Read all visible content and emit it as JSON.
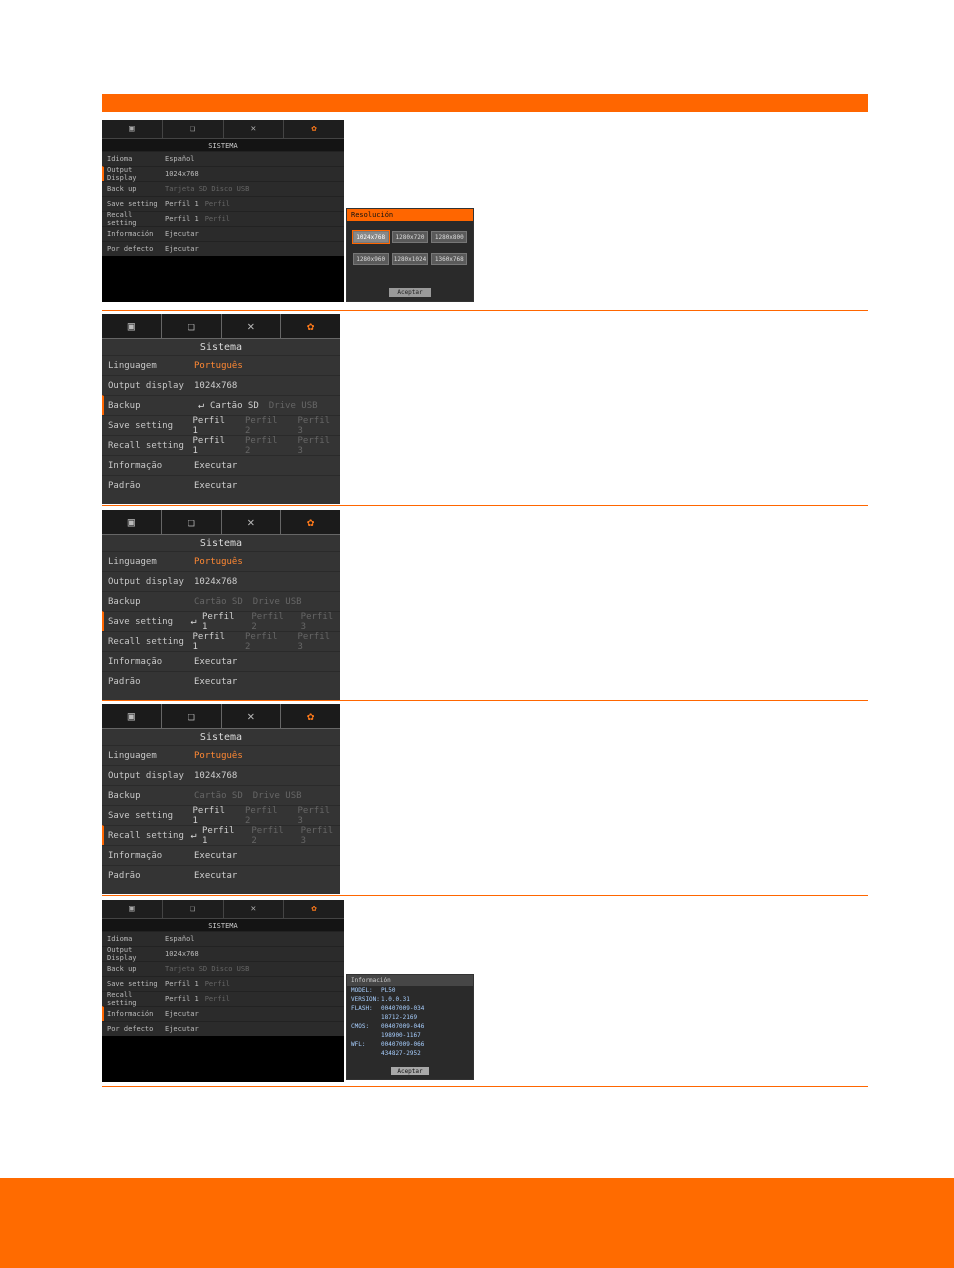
{
  "tabs": {
    "icon1": "picture-icon",
    "icon2": "layers-icon",
    "icon3": "tools-icon",
    "icon4": "gear-icon"
  },
  "p1": {
    "title": "SISTEMA",
    "rows": {
      "lang_label": "Idioma",
      "lang_value": "Español",
      "out_label": "Output Display",
      "out_value": "1024x768",
      "back_label": "Back up",
      "back_value": "Tarjeta SD  Disco USB",
      "save_label": "Save setting",
      "save_v1": "Perfil 1",
      "save_v2": "Perfil",
      "recall_label": "Recall setting",
      "recall_v1": "Perfil 1",
      "recall_v2": "Perfil",
      "info_label": "Información",
      "info_value": "Ejecutar",
      "def_label": "Por defecto",
      "def_value": "Ejecutar"
    },
    "popup": {
      "title": "Resolución",
      "options": [
        "1024x768",
        "1280x720",
        "1280x800",
        "1280x960",
        "1280x1024",
        "1360x768"
      ],
      "ok": "Aceptar"
    }
  },
  "mid": {
    "title": "Sistema",
    "rows": {
      "lang_label": "Linguagem",
      "lang_value": "Português",
      "out_label": "Output display",
      "out_value": "1024x768",
      "back_label": "Backup",
      "back_v1": "Cartão SD",
      "back_v2": "Drive USB",
      "save_label": "Save setting",
      "p1": "Perfil 1",
      "p2": "Perfil 2",
      "p3": "Perfil 3",
      "recall_label": "Recall setting",
      "info_label": "Informação",
      "info_value": "Executar",
      "def_label": "Padrão",
      "def_value": "Executar"
    }
  },
  "p5": {
    "title": "SISTEMA",
    "rows": {
      "lang_label": "Idioma",
      "lang_value": "Español",
      "out_label": "Output Display",
      "out_value": "1024x768",
      "back_label": "Back up",
      "back_value": "Tarjeta SD  Disco USB",
      "save_label": "Save setting",
      "save_v1": "Perfil 1",
      "save_v2": "Perfil",
      "recall_label": "Recall setting",
      "recall_v1": "Perfil 1",
      "recall_v2": "Perfil",
      "info_label": "Información",
      "info_value": "Ejecutar",
      "def_label": "Por defecto",
      "def_value": "Ejecutar"
    },
    "info": {
      "title": "Información",
      "k_model": "MODEL:",
      "v_model": "PL50",
      "k_version": "VERSION:",
      "v_version": "1.0.0.31",
      "k_flash": "FLASH:",
      "v_flash": "00407009-034",
      "k_flash2": "",
      "v_flash2": "18712-2169",
      "k_cmos": "CMOS:",
      "v_cmos": "00407009-046",
      "k_cmos2": "",
      "v_cmos2": "198900-1167",
      "k_wf": "WFL:",
      "v_wf": "00407009-066",
      "k_wf2": "",
      "v_wf2": "434827-2952",
      "ok": "Aceptar"
    }
  }
}
